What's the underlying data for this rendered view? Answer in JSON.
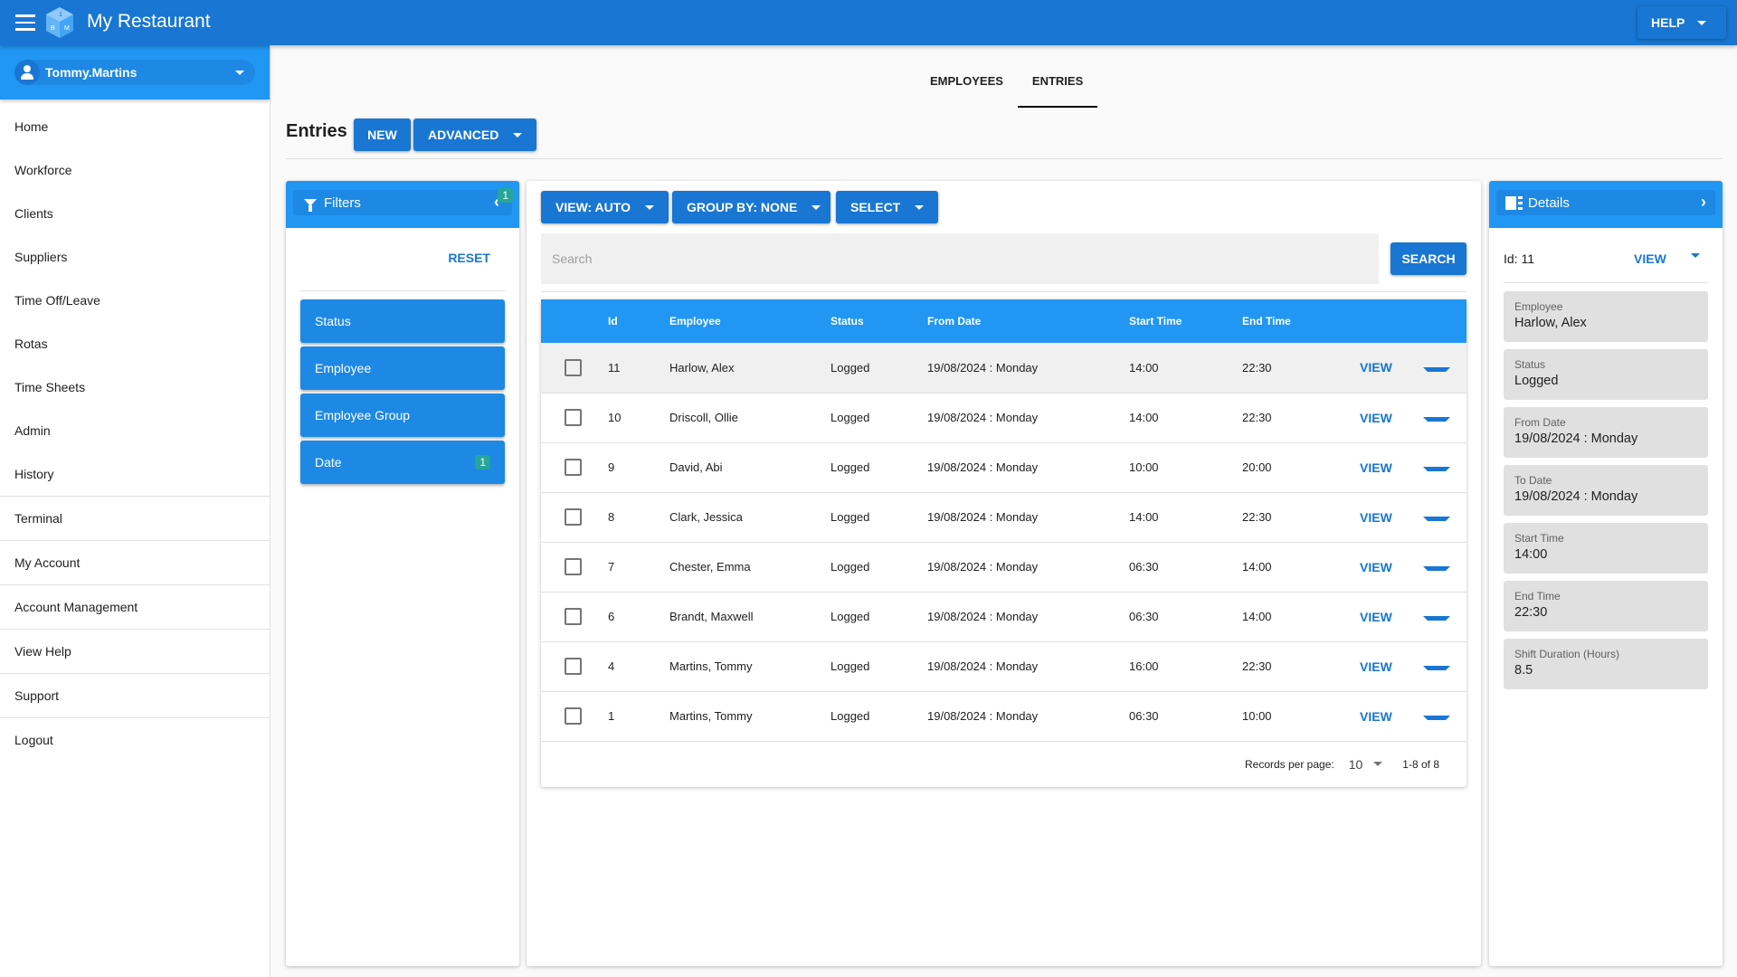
{
  "app": {
    "title": "My Restaurant",
    "help_label": "HELP"
  },
  "user": {
    "name": "Tommy.Martins"
  },
  "sidebar": {
    "items": [
      {
        "label": "Home"
      },
      {
        "label": "Workforce"
      },
      {
        "label": "Clients"
      },
      {
        "label": "Suppliers"
      },
      {
        "label": "Time Off/Leave"
      },
      {
        "label": "Rotas"
      },
      {
        "label": "Time Sheets"
      },
      {
        "label": "Admin"
      },
      {
        "label": "History"
      },
      {
        "label": "Terminal"
      },
      {
        "label": "My Account"
      },
      {
        "label": "Account Management"
      },
      {
        "label": "View Help"
      },
      {
        "label": "Support"
      },
      {
        "label": "Logout"
      }
    ]
  },
  "tabs": [
    {
      "label": "EMPLOYEES",
      "active": false
    },
    {
      "label": "ENTRIES",
      "active": true
    }
  ],
  "page": {
    "title": "Entries",
    "new_label": "NEW",
    "advanced_label": "ADVANCED"
  },
  "filters": {
    "title": "Filters",
    "active_count": "1",
    "reset_label": "RESET",
    "items": [
      {
        "label": "Status",
        "count": null
      },
      {
        "label": "Employee",
        "count": null
      },
      {
        "label": "Employee Group",
        "count": null
      },
      {
        "label": "Date",
        "count": "1"
      }
    ]
  },
  "toolbar": {
    "view_label": "VIEW: AUTO",
    "group_label": "GROUP BY: NONE",
    "select_label": "SELECT",
    "search_placeholder": "Search",
    "search_value": "",
    "search_button": "SEARCH"
  },
  "table": {
    "columns": [
      "Id",
      "Employee",
      "Status",
      "From Date",
      "Start Time",
      "End Time"
    ],
    "view_label": "VIEW",
    "rows": [
      {
        "id": "11",
        "employee": "Harlow, Alex",
        "status": "Logged",
        "from_date": "19/08/2024 : Monday",
        "start": "14:00",
        "end": "22:30",
        "selected": true
      },
      {
        "id": "10",
        "employee": "Driscoll, Ollie",
        "status": "Logged",
        "from_date": "19/08/2024 : Monday",
        "start": "14:00",
        "end": "22:30"
      },
      {
        "id": "9",
        "employee": "David, Abi",
        "status": "Logged",
        "from_date": "19/08/2024 : Monday",
        "start": "10:00",
        "end": "20:00"
      },
      {
        "id": "8",
        "employee": "Clark, Jessica",
        "status": "Logged",
        "from_date": "19/08/2024 : Monday",
        "start": "14:00",
        "end": "22:30"
      },
      {
        "id": "7",
        "employee": "Chester, Emma",
        "status": "Logged",
        "from_date": "19/08/2024 : Monday",
        "start": "06:30",
        "end": "14:00"
      },
      {
        "id": "6",
        "employee": "Brandt, Maxwell",
        "status": "Logged",
        "from_date": "19/08/2024 : Monday",
        "start": "06:30",
        "end": "14:00"
      },
      {
        "id": "4",
        "employee": "Martins, Tommy",
        "status": "Logged",
        "from_date": "19/08/2024 : Monday",
        "start": "16:00",
        "end": "22:30"
      },
      {
        "id": "1",
        "employee": "Martins, Tommy",
        "status": "Logged",
        "from_date": "19/08/2024 : Monday",
        "start": "06:30",
        "end": "10:00"
      }
    ],
    "footer": {
      "rpp_label": "Records per page:",
      "rpp_value": "10",
      "range": "1-8 of 8"
    }
  },
  "details": {
    "title": "Details",
    "id_label": "Id: 11",
    "view_label": "VIEW",
    "fields": [
      {
        "label": "Employee",
        "value": "Harlow, Alex"
      },
      {
        "label": "Status",
        "value": "Logged"
      },
      {
        "label": "From Date",
        "value": "19/08/2024 : Monday"
      },
      {
        "label": "To Date",
        "value": "19/08/2024 : Monday"
      },
      {
        "label": "Start Time",
        "value": "14:00"
      },
      {
        "label": "End Time",
        "value": "22:30"
      },
      {
        "label": "Shift Duration (Hours)",
        "value": "8.5"
      }
    ]
  },
  "colors": {
    "primary": "#1976d2",
    "header": "#2196f3",
    "badge": "#26a69a"
  }
}
